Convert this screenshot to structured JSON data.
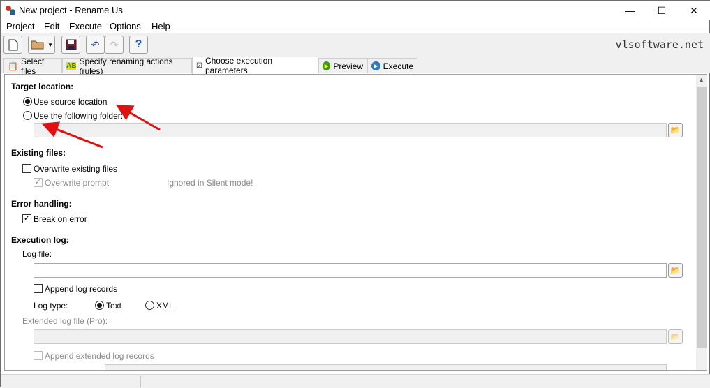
{
  "window": {
    "title": "New project - Rename Us",
    "minimize": "—",
    "maximize": "☐",
    "close": "✕"
  },
  "menu": [
    "Project",
    "Edit",
    "Execute",
    "Options",
    "Help"
  ],
  "brand": "vlsoftware.net",
  "tabs": [
    {
      "label": "Select files",
      "icon": "clipboard-icon"
    },
    {
      "label": "Specify renaming actions (rules)",
      "icon": "ab-rename-icon"
    },
    {
      "label": "Choose execution parameters",
      "icon": "checklist-icon",
      "active": true
    },
    {
      "label": "Preview",
      "icon": "play-icon"
    },
    {
      "label": "Execute",
      "icon": "execute-icon"
    }
  ],
  "target": {
    "heading": "Target location:",
    "use_source": "Use source location",
    "use_folder": "Use the following folder:",
    "folder_value": "",
    "selected": "source"
  },
  "existing": {
    "heading": "Existing files:",
    "overwrite": "Overwrite existing files",
    "overwrite_checked": false,
    "prompt": "Overwrite prompt",
    "prompt_checked": true,
    "note": "Ignored in Silent mode!"
  },
  "error": {
    "heading": "Error handling:",
    "break": "Break on error",
    "break_checked": true
  },
  "log": {
    "heading": "Execution log:",
    "file_label": "Log file:",
    "file_value": "",
    "append": "Append log records",
    "append_checked": false,
    "type_label": "Log type:",
    "type_text": "Text",
    "type_xml": "XML",
    "type_selected": "Text",
    "ext_label": "Extended log file (Pro):",
    "ext_value": "",
    "ext_append": "Append extended log records"
  }
}
